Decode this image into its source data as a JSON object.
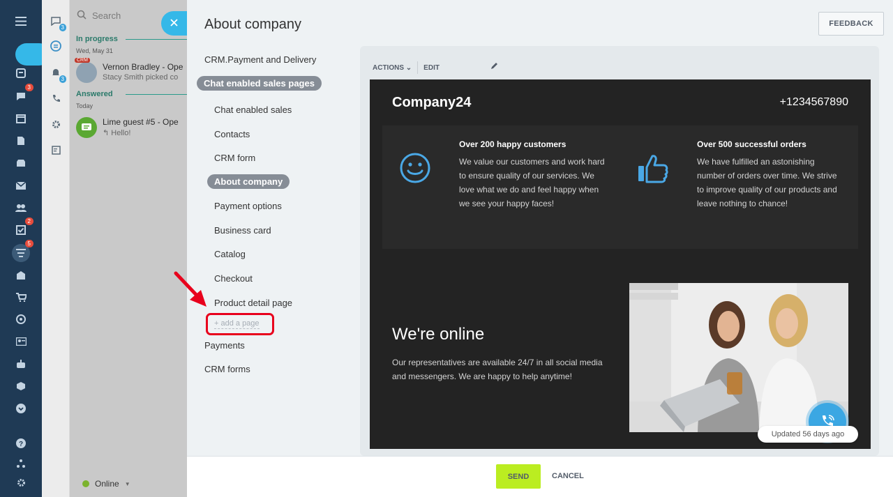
{
  "chat_list": {
    "search_placeholder": "Search",
    "section_in_progress": "In progress",
    "date_1": "Wed, May 31",
    "chat_1_badge": "CRM",
    "chat_1_name": "Vernon Bradley - Ope",
    "chat_1_sub": "Stacy Smith picked co",
    "section_answered": "Answered",
    "date_2": "Today",
    "chat_2_name": "Lime guest #5 - Ope",
    "chat_2_sub": "Hello!",
    "status": "Online"
  },
  "rail_badges": {
    "chat": "3",
    "tasks": "2",
    "filter": "5"
  },
  "messenger_badges": {
    "chat": "3",
    "bell": "3"
  },
  "panel": {
    "title": "About company",
    "feedback_label": "FEEDBACK"
  },
  "nav": {
    "items": [
      "CRM.Payment and Delivery",
      "Chat enabled sales pages",
      "Chat enabled sales",
      "Contacts",
      "CRM form",
      "About company",
      "Payment options",
      "Business card",
      "Catalog",
      "Checkout",
      "Product detail page",
      "Payments",
      "CRM forms"
    ],
    "add_page": "+ add a page"
  },
  "toolbar": {
    "actions": "ACTIONS",
    "edit": "EDIT"
  },
  "site": {
    "brand": "Company24",
    "phone": "+1234567890",
    "feature_1_title": "Over 200 happy customers",
    "feature_1_text": "We value our customers and work hard to ensure quality of our services. We love what we do and feel happy when we see your happy faces!",
    "feature_2_title": "Over 500 successful orders",
    "feature_2_text": "We have fulfilled an astonishing number of orders over time. We strive to improve quality of our products and leave nothing to chance!",
    "online_title": "We're online",
    "online_text": "Our representatives are available 24/7 in all social media and messengers. We are happy to help anytime!"
  },
  "updated_label": "Updated 56 days ago",
  "footer": {
    "send": "SEND",
    "cancel": "CANCEL"
  },
  "colors": {
    "accent": "#35b8e8",
    "send": "#bbed21",
    "highlight": "#e8001c"
  }
}
